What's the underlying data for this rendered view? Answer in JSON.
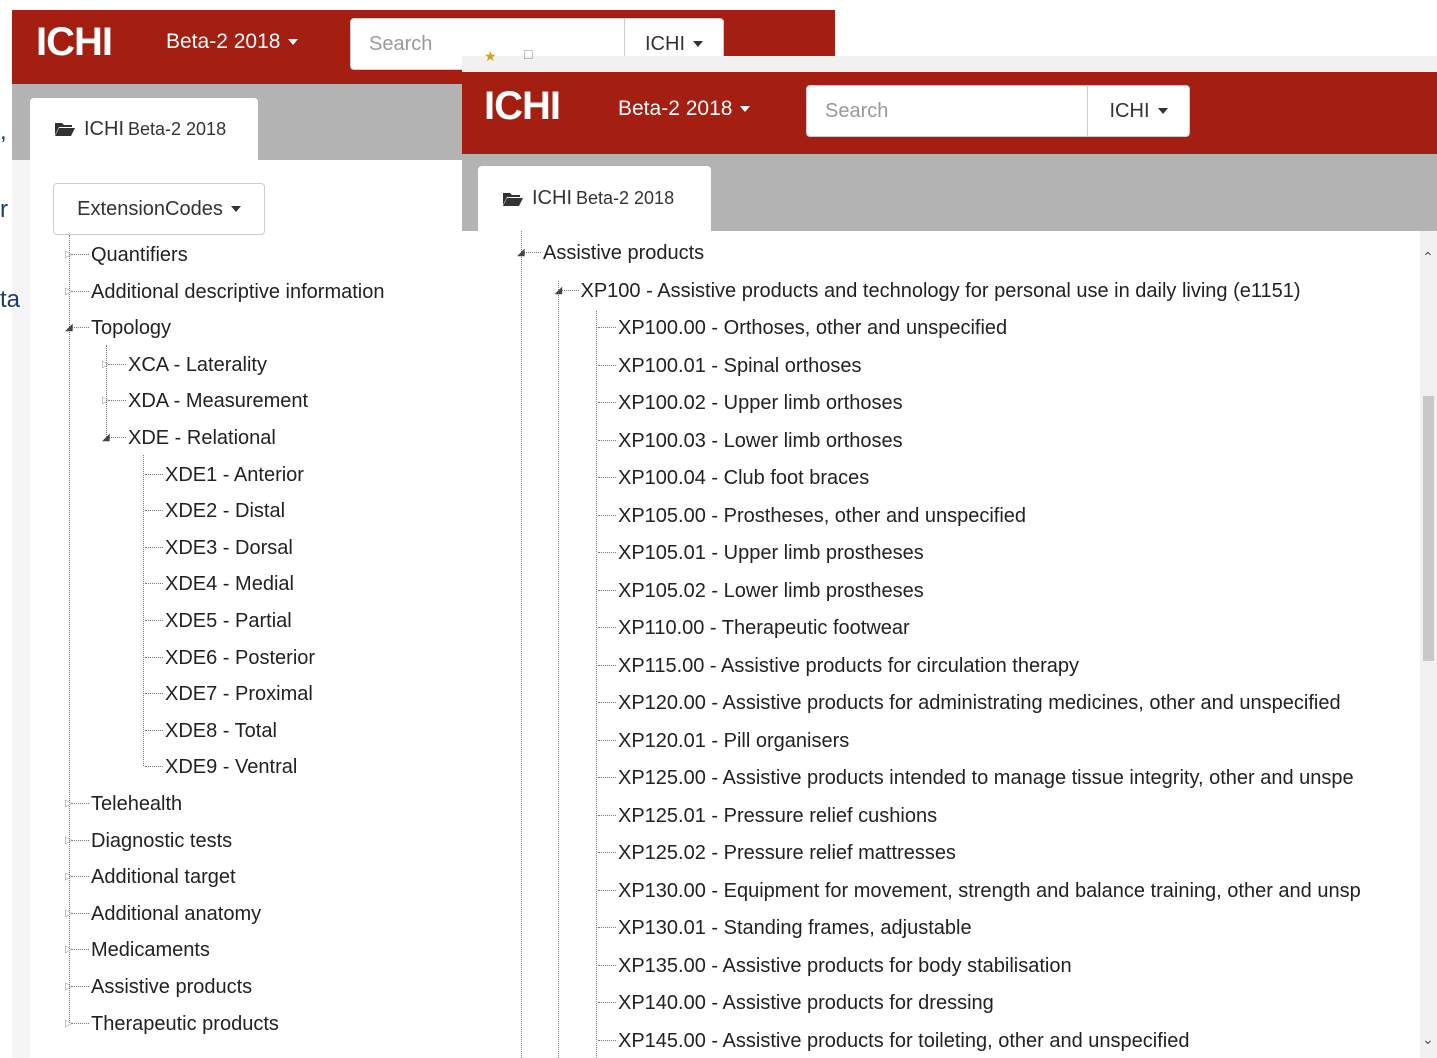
{
  "edge_chars": [
    ",",
    "r",
    "ta"
  ],
  "window_back": {
    "brand": "ICHI",
    "version_label": "Beta-2 2018",
    "search_placeholder": "Search",
    "search_scope": "ICHI",
    "tab": {
      "title": "ICHI",
      "subtitle": "Beta-2 2018"
    },
    "dropdown_label": "ExtensionCodes",
    "tree": [
      {
        "label": "Quantifiers",
        "code": "",
        "sep": ""
      },
      {
        "label": "Additional descriptive information",
        "code": "",
        "sep": ""
      },
      {
        "label": "Topology",
        "code": "",
        "sep": ""
      },
      {
        "code": "XCA",
        "sep": " - ",
        "label": "Laterality"
      },
      {
        "code": "XDA",
        "sep": " - ",
        "label": "Measurement"
      },
      {
        "code": "XDE",
        "sep": " - ",
        "label": "Relational"
      },
      {
        "code": "XDE1",
        "sep": " - ",
        "label": "Anterior"
      },
      {
        "code": "XDE2",
        "sep": " - ",
        "label": "Distal"
      },
      {
        "code": "XDE3",
        "sep": " - ",
        "label": "Dorsal"
      },
      {
        "code": "XDE4",
        "sep": " - ",
        "label": "Medial"
      },
      {
        "code": "XDE5",
        "sep": " - ",
        "label": "Partial"
      },
      {
        "code": "XDE6",
        "sep": " - ",
        "label": "Posterior"
      },
      {
        "code": "XDE7",
        "sep": " - ",
        "label": "Proximal"
      },
      {
        "code": "XDE8",
        "sep": " - ",
        "label": "Total"
      },
      {
        "code": "XDE9",
        "sep": " - ",
        "label": "Ventral"
      },
      {
        "label": "Telehealth",
        "code": "",
        "sep": ""
      },
      {
        "label": "Diagnostic tests",
        "code": "",
        "sep": ""
      },
      {
        "label": "Additional target",
        "code": "",
        "sep": ""
      },
      {
        "label": "Additional anatomy",
        "code": "",
        "sep": ""
      },
      {
        "label": "Medicaments",
        "code": "",
        "sep": ""
      },
      {
        "label": "Assistive products",
        "code": "",
        "sep": ""
      },
      {
        "label": "Therapeutic products",
        "code": "",
        "sep": ""
      }
    ]
  },
  "window_front": {
    "brand": "ICHI",
    "version_label": "Beta-2 2018",
    "search_placeholder": "Search",
    "search_scope": "ICHI",
    "tab": {
      "title": "ICHI",
      "subtitle": "Beta-2 2018"
    },
    "tree": [
      {
        "code": "",
        "sep": "",
        "label": "Assistive products"
      },
      {
        "code": "XP100",
        "sep": " - ",
        "label": "Assistive products and technology for personal use in daily living (e1151)"
      },
      {
        "code": "XP100.00",
        "sep": " - ",
        "label": "Orthoses, other and unspecified"
      },
      {
        "code": "XP100.01",
        "sep": " - ",
        "label": "Spinal orthoses"
      },
      {
        "code": "XP100.02",
        "sep": " - ",
        "label": "Upper limb orthoses"
      },
      {
        "code": "XP100.03",
        "sep": " - ",
        "label": "Lower limb orthoses"
      },
      {
        "code": "XP100.04",
        "sep": " - ",
        "label": "Club foot braces"
      },
      {
        "code": "XP105.00",
        "sep": " - ",
        "label": "Prostheses, other and unspecified"
      },
      {
        "code": "XP105.01",
        "sep": " - ",
        "label": "Upper limb prostheses"
      },
      {
        "code": "XP105.02",
        "sep": " - ",
        "label": "Lower limb prostheses"
      },
      {
        "code": "XP110.00",
        "sep": " - ",
        "label": "Therapeutic footwear"
      },
      {
        "code": "XP115.00",
        "sep": " - ",
        "label": "Assistive products for circulation therapy"
      },
      {
        "code": "XP120.00",
        "sep": " - ",
        "label": "Assistive products for administrating medicines, other and unspecified"
      },
      {
        "code": "XP120.01",
        "sep": " - ",
        "label": "Pill organisers"
      },
      {
        "code": "XP125.00",
        "sep": " - ",
        "label": "Assistive products intended to manage tissue integrity, other and unspe"
      },
      {
        "code": "XP125.01",
        "sep": " - ",
        "label": "Pressure relief cushions"
      },
      {
        "code": "XP125.02",
        "sep": " - ",
        "label": "Pressure relief mattresses"
      },
      {
        "code": "XP130.00",
        "sep": " - ",
        "label": "Equipment for movement, strength and balance training, other and unsp"
      },
      {
        "code": "XP130.01",
        "sep": " - ",
        "label": "Standing frames, adjustable"
      },
      {
        "code": "XP135.00",
        "sep": " - ",
        "label": "Assistive products for body stabilisation"
      },
      {
        "code": "XP140.00",
        "sep": " - ",
        "label": "Assistive products for dressing"
      },
      {
        "code": "XP145.00",
        "sep": " - ",
        "label": "Assistive products for toileting, other and unspecified"
      }
    ]
  },
  "colors": {
    "navbar": "#a51e12",
    "tabstrip": "#b3b3b3",
    "edge_text": "#1a3c6e"
  }
}
